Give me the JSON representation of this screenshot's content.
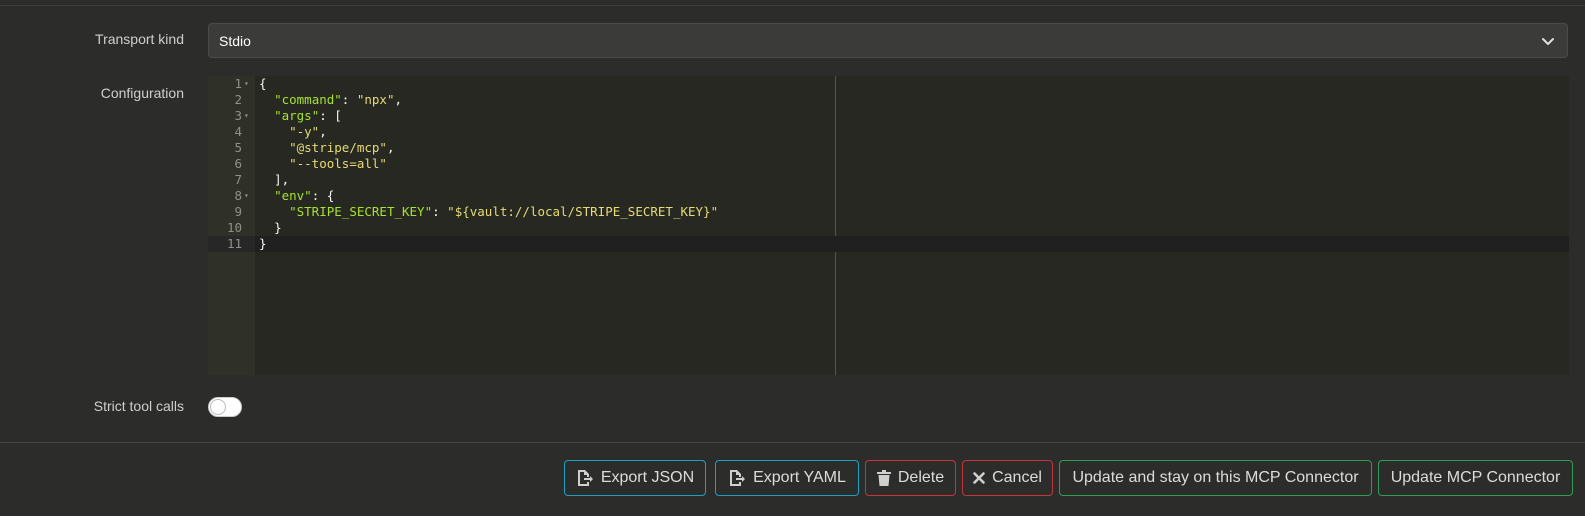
{
  "form": {
    "transport_label": "Transport kind",
    "transport_value": "Stdio",
    "configuration_label": "Configuration",
    "strict_label": "Strict tool calls",
    "strict_enabled": false
  },
  "editor": {
    "line_numbers": [
      "1",
      "2",
      "3",
      "4",
      "5",
      "6",
      "7",
      "8",
      "9",
      "10",
      "11"
    ],
    "lines": [
      "{",
      "  \"command\": \"npx\",",
      "  \"args\": [",
      "    \"-y\",",
      "    \"@stripe/mcp\",",
      "    \"--tools=all\"",
      "  ],",
      "  \"env\": {",
      "    \"STRIPE_SECRET_KEY\": \"${vault://local/STRIPE_SECRET_KEY}\"",
      "  }",
      "}"
    ],
    "tokens": {
      "command_key": "\"command\"",
      "command_val": "\"npx\"",
      "args_key": "\"args\"",
      "arg1": "\"-y\"",
      "arg2": "\"@stripe/mcp\"",
      "arg3": "\"--tools=all\"",
      "env_key": "\"env\"",
      "secret_key": "\"STRIPE_SECRET_KEY\"",
      "secret_val": "\"${vault://local/STRIPE_SECRET_KEY}\""
    }
  },
  "actions": {
    "export_json": "Export JSON",
    "export_yaml": "Export YAML",
    "delete": "Delete",
    "cancel": "Cancel",
    "update_stay": "Update and stay on this MCP Connector",
    "update": "Update MCP Connector"
  },
  "colors": {
    "info": "#1d9fc2",
    "danger": "#c6353b",
    "success": "#2f9e55",
    "json_key": "#a6e22e",
    "json_string": "#e6db74"
  }
}
